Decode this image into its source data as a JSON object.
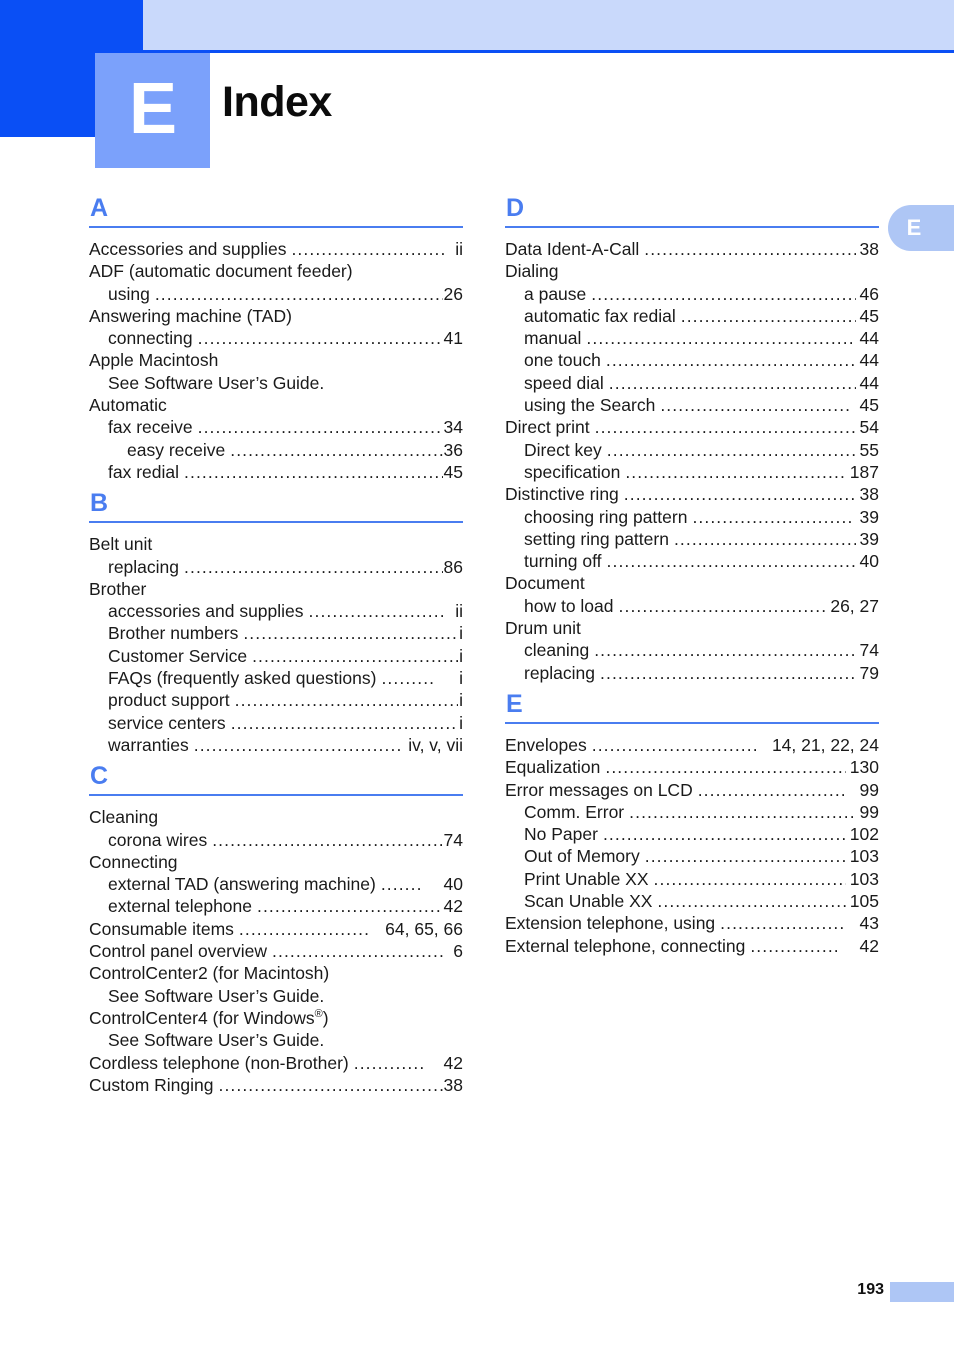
{
  "header": {
    "chapter_letter": "E",
    "title": "Index",
    "colors": {
      "dark_blue": "#0A4FF5",
      "light_blue": "#C9D9FB",
      "badge_blue": "#7BA1FB",
      "section_blue": "#4A7DF0",
      "tab_blue": "#AEC6F5"
    }
  },
  "edge_tab": {
    "letter": "E"
  },
  "footer": {
    "page_number": "193"
  },
  "columns": [
    {
      "name": "left",
      "sections": [
        {
          "letter": "A",
          "entries": [
            {
              "level": 0,
              "label": "Accessories and supplies",
              "leader": "..........................",
              "page": "ii"
            },
            {
              "level": 0,
              "label": "ADF (automatic document feeder)",
              "leader": "",
              "page": ""
            },
            {
              "level": 1,
              "label": "using",
              "leader": ".......................................................",
              "page": "26"
            },
            {
              "level": 0,
              "label": "Answering machine (TAD)",
              "leader": "",
              "page": ""
            },
            {
              "level": 1,
              "label": "connecting",
              "leader": "...........................................",
              "page": "41"
            },
            {
              "level": 0,
              "label": "Apple Macintosh",
              "leader": "",
              "page": ""
            },
            {
              "level": 1,
              "label": "See Software User’s Guide.",
              "leader": "",
              "page": ""
            },
            {
              "level": 0,
              "label": "Automatic",
              "leader": "",
              "page": ""
            },
            {
              "level": 1,
              "label": "fax receive",
              "leader": "...........................................",
              "page": "34"
            },
            {
              "level": 2,
              "label": "easy receive",
              "leader": ".......................................",
              "page": "36"
            },
            {
              "level": 1,
              "label": "fax redial",
              "leader": "..............................................",
              "page": "45"
            }
          ]
        },
        {
          "letter": "B",
          "entries": [
            {
              "level": 0,
              "label": "Belt unit",
              "leader": "",
              "page": ""
            },
            {
              "level": 1,
              "label": "replacing",
              "leader": "..............................................",
              "page": "86"
            },
            {
              "level": 0,
              "label": "Brother",
              "leader": "",
              "page": ""
            },
            {
              "level": 1,
              "label": "accessories and supplies",
              "leader": ".......................",
              "page": "ii"
            },
            {
              "level": 1,
              "label": "Brother numbers",
              "leader": ".....................................",
              "page": "i"
            },
            {
              "level": 1,
              "label": "Customer Service",
              "leader": "...................................",
              "page": "i"
            },
            {
              "level": 1,
              "label": "FAQs (frequently asked questions)",
              "leader": ".........",
              "page": "i"
            },
            {
              "level": 1,
              "label": "product support",
              "leader": ".......................................",
              "page": "i"
            },
            {
              "level": 1,
              "label": "service centers",
              "leader": "........................................",
              "page": "i"
            },
            {
              "level": 1,
              "label": "warranties",
              "leader": "...................................",
              "page": "iv, v, vii"
            }
          ]
        },
        {
          "letter": "C",
          "entries": [
            {
              "level": 0,
              "label": "Cleaning",
              "leader": "",
              "page": ""
            },
            {
              "level": 1,
              "label": "corona wires",
              "leader": ".........................................",
              "page": "74"
            },
            {
              "level": 0,
              "label": "Connecting",
              "leader": "",
              "page": ""
            },
            {
              "level": 1,
              "label": "external TAD (answering machine)",
              "leader": ".......",
              "page": "40"
            },
            {
              "level": 1,
              "label": "external telephone",
              "leader": "................................",
              "page": "42"
            },
            {
              "level": 0,
              "label": "Consumable items",
              "leader": "......................",
              "page": "64, 65, 66"
            },
            {
              "level": 0,
              "label": "Control panel overview",
              "leader": ".............................",
              "page": "6"
            },
            {
              "level": 0,
              "label": "ControlCenter2 (for Macintosh)",
              "leader": "",
              "page": ""
            },
            {
              "level": 1,
              "label": "See Software User’s Guide.",
              "leader": "",
              "page": ""
            },
            {
              "level": 0,
              "label": "ControlCenter4 (for Windows®)",
              "leader": "",
              "page": "",
              "has_reg": true,
              "label_before": "ControlCenter4 (for Windows",
              "label_after": ")"
            },
            {
              "level": 1,
              "label": "See Software User’s Guide.",
              "leader": "",
              "page": ""
            },
            {
              "level": 0,
              "label": "Cordless telephone (non-Brother)",
              "leader": "............",
              "page": "42"
            },
            {
              "level": 0,
              "label": "Custom Ringing",
              "leader": ".......................................",
              "page": "38"
            }
          ]
        }
      ]
    },
    {
      "name": "right",
      "sections": [
        {
          "letter": "D",
          "entries": [
            {
              "level": 0,
              "label": "Data Ident-A-Call",
              "leader": "....................................",
              "page": "38"
            },
            {
              "level": 0,
              "label": "Dialing",
              "leader": "",
              "page": ""
            },
            {
              "level": 1,
              "label": "a pause",
              "leader": "................................................",
              "page": "46"
            },
            {
              "level": 1,
              "label": "automatic fax redial",
              "leader": "..............................",
              "page": "45"
            },
            {
              "level": 1,
              "label": "manual",
              "leader": "................................................",
              "page": "44"
            },
            {
              "level": 1,
              "label": "one touch",
              "leader": "............................................",
              "page": "44"
            },
            {
              "level": 1,
              "label": "speed dial",
              "leader": "............................................",
              "page": "44"
            },
            {
              "level": 1,
              "label": "using the Search",
              "leader": "................................",
              "page": "45"
            },
            {
              "level": 0,
              "label": "Direct print",
              "leader": ".............................................",
              "page": "54"
            },
            {
              "level": 1,
              "label": "Direct key",
              "leader": ".............................................",
              "page": "55"
            },
            {
              "level": 1,
              "label": "specification",
              "leader": ".......................................",
              "page": "187"
            },
            {
              "level": 0,
              "label": "Distinctive ring",
              "leader": "........................................",
              "page": "38"
            },
            {
              "level": 1,
              "label": "choosing ring pattern",
              "leader": "...........................",
              "page": "39"
            },
            {
              "level": 1,
              "label": "setting ring pattern",
              "leader": "...............................",
              "page": "39"
            },
            {
              "level": 1,
              "label": "turning off",
              "leader": "...........................................",
              "page": "40"
            },
            {
              "level": 0,
              "label": "Document",
              "leader": "",
              "page": ""
            },
            {
              "level": 1,
              "label": "how to load",
              "leader": ".....................................",
              "page": "26, 27"
            },
            {
              "level": 0,
              "label": "Drum unit",
              "leader": "",
              "page": ""
            },
            {
              "level": 1,
              "label": "cleaning",
              "leader": "................................................",
              "page": "74"
            },
            {
              "level": 1,
              "label": "replacing",
              "leader": "..............................................",
              "page": "79"
            }
          ]
        },
        {
          "letter": "E",
          "entries": [
            {
              "level": 0,
              "label": "Envelopes",
              "leader": "............................",
              "page": "14, 21, 22, 24"
            },
            {
              "level": 0,
              "label": "Equalization",
              "leader": "..........................................",
              "page": "130"
            },
            {
              "level": 0,
              "label": "Error messages on LCD",
              "leader": ".........................",
              "page": "99"
            },
            {
              "level": 1,
              "label": "Comm. Error",
              "leader": "........................................",
              "page": "99"
            },
            {
              "level": 1,
              "label": "No Paper",
              "leader": "..........................................",
              "page": "102"
            },
            {
              "level": 1,
              "label": "Out of Memory",
              "leader": "...................................",
              "page": "103"
            },
            {
              "level": 1,
              "label": "Print Unable XX",
              "leader": "..................................",
              "page": "103"
            },
            {
              "level": 1,
              "label": "Scan Unable XX",
              "leader": ".................................",
              "page": "105"
            },
            {
              "level": 0,
              "label": "Extension telephone, using",
              "leader": ".....................",
              "page": "43"
            },
            {
              "level": 0,
              "label": "External telephone, connecting",
              "leader": "...............",
              "page": "42"
            }
          ]
        }
      ]
    }
  ]
}
